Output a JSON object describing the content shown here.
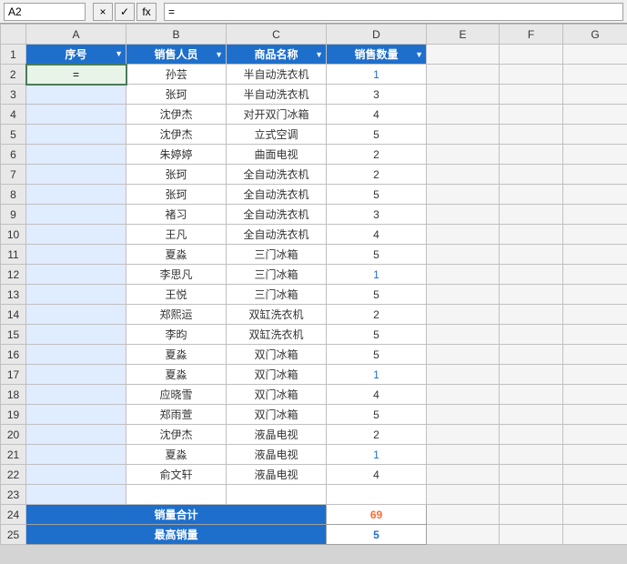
{
  "formulaBar": {
    "nameBox": "A2",
    "cancelBtn": "×",
    "confirmBtn": "✓",
    "funcBtn": "fx",
    "formula": "="
  },
  "columns": {
    "rowHeader": "",
    "a": "序号",
    "b": "销售人员",
    "c": "商品名称",
    "d": "销售数量",
    "e": "E",
    "f": "F",
    "g": "G"
  },
  "rows": [
    {
      "num": "2",
      "a": "",
      "b": "孙芸",
      "c": "半自动洗衣机",
      "d": "1",
      "dBlue": true
    },
    {
      "num": "3",
      "a": "",
      "b": "张珂",
      "c": "半自动洗衣机",
      "d": "3"
    },
    {
      "num": "4",
      "a": "",
      "b": "沈伊杰",
      "c": "对开双门冰箱",
      "d": "4"
    },
    {
      "num": "5",
      "a": "",
      "b": "沈伊杰",
      "c": "立式空调",
      "d": "5"
    },
    {
      "num": "6",
      "a": "",
      "b": "朱婷婷",
      "c": "曲面电视",
      "d": "2"
    },
    {
      "num": "7",
      "a": "",
      "b": "张珂",
      "c": "全自动洗衣机",
      "d": "2"
    },
    {
      "num": "8",
      "a": "",
      "b": "张珂",
      "c": "全自动洗衣机",
      "d": "5"
    },
    {
      "num": "9",
      "a": "",
      "b": "褚习",
      "c": "全自动洗衣机",
      "d": "3"
    },
    {
      "num": "10",
      "a": "",
      "b": "王凡",
      "c": "全自动洗衣机",
      "d": "4"
    },
    {
      "num": "11",
      "a": "",
      "b": "夏淼",
      "c": "三门冰箱",
      "d": "5"
    },
    {
      "num": "12",
      "a": "",
      "b": "李思凡",
      "c": "三门冰箱",
      "d": "1",
      "dBlue": true
    },
    {
      "num": "13",
      "a": "",
      "b": "王悦",
      "c": "三门冰箱",
      "d": "5"
    },
    {
      "num": "14",
      "a": "",
      "b": "郑熙运",
      "c": "双缸洗衣机",
      "d": "2"
    },
    {
      "num": "15",
      "a": "",
      "b": "李昀",
      "c": "双缸洗衣机",
      "d": "5"
    },
    {
      "num": "16",
      "a": "",
      "b": "夏淼",
      "c": "双门冰箱",
      "d": "5"
    },
    {
      "num": "17",
      "a": "",
      "b": "夏淼",
      "c": "双门冰箱",
      "d": "1",
      "dBlue": true
    },
    {
      "num": "18",
      "a": "",
      "b": "应晓雪",
      "c": "双门冰箱",
      "d": "4"
    },
    {
      "num": "19",
      "a": "",
      "b": "郑雨萱",
      "c": "双门冰箱",
      "d": "5"
    },
    {
      "num": "20",
      "a": "",
      "b": "沈伊杰",
      "c": "液晶电视",
      "d": "2"
    },
    {
      "num": "21",
      "a": "",
      "b": "夏淼",
      "c": "液晶电视",
      "d": "1",
      "dBlue": true
    },
    {
      "num": "22",
      "a": "",
      "b": "俞文轩",
      "c": "液晶电视",
      "d": "4"
    }
  ],
  "emptyRow": {
    "num": "23"
  },
  "totalRow": {
    "num": "24",
    "label": "销量合计",
    "value": "69"
  },
  "summaryRow": {
    "num": "25",
    "label": "最高销量",
    "value": "5"
  }
}
